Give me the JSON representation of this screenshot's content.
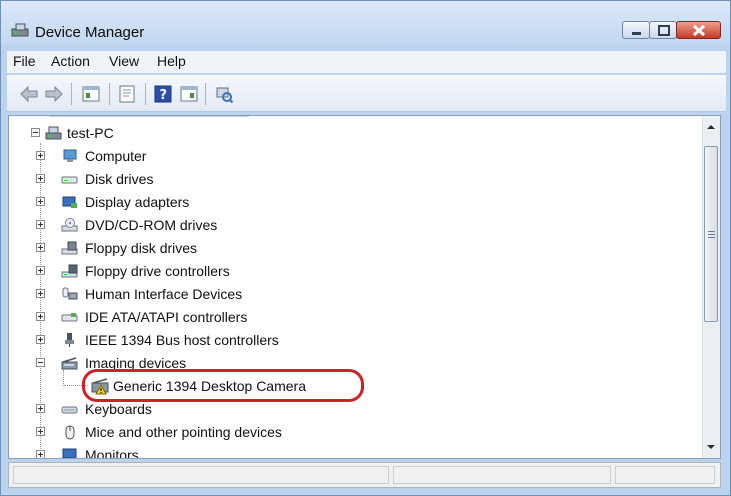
{
  "window": {
    "title": "Device Manager",
    "controls": [
      "minimize",
      "maximize",
      "close"
    ],
    "accent_color": "#d0202a"
  },
  "menu": [
    "File",
    "Action",
    "View",
    "Help"
  ],
  "toolbar": [
    "back-arrow-icon",
    "forward-arrow-icon",
    "show-hide-tree-icon",
    "properties-icon",
    "help-icon",
    "action-pane-icon",
    "scan-hardware-icon"
  ],
  "tree": {
    "root": "test-PC",
    "categories": [
      "Computer",
      "Disk drives",
      "Display adapters",
      "DVD/CD-ROM drives",
      "Floppy disk drives",
      "Floppy drive controllers",
      "Human Interface Devices",
      "IDE ATA/ATAPI controllers",
      "IEEE 1394 Bus host controllers",
      "Imaging devices",
      "Keyboards",
      "Mice and other pointing devices",
      "Monitors"
    ],
    "imaging_child": "Generic 1394 Desktop Camera"
  }
}
